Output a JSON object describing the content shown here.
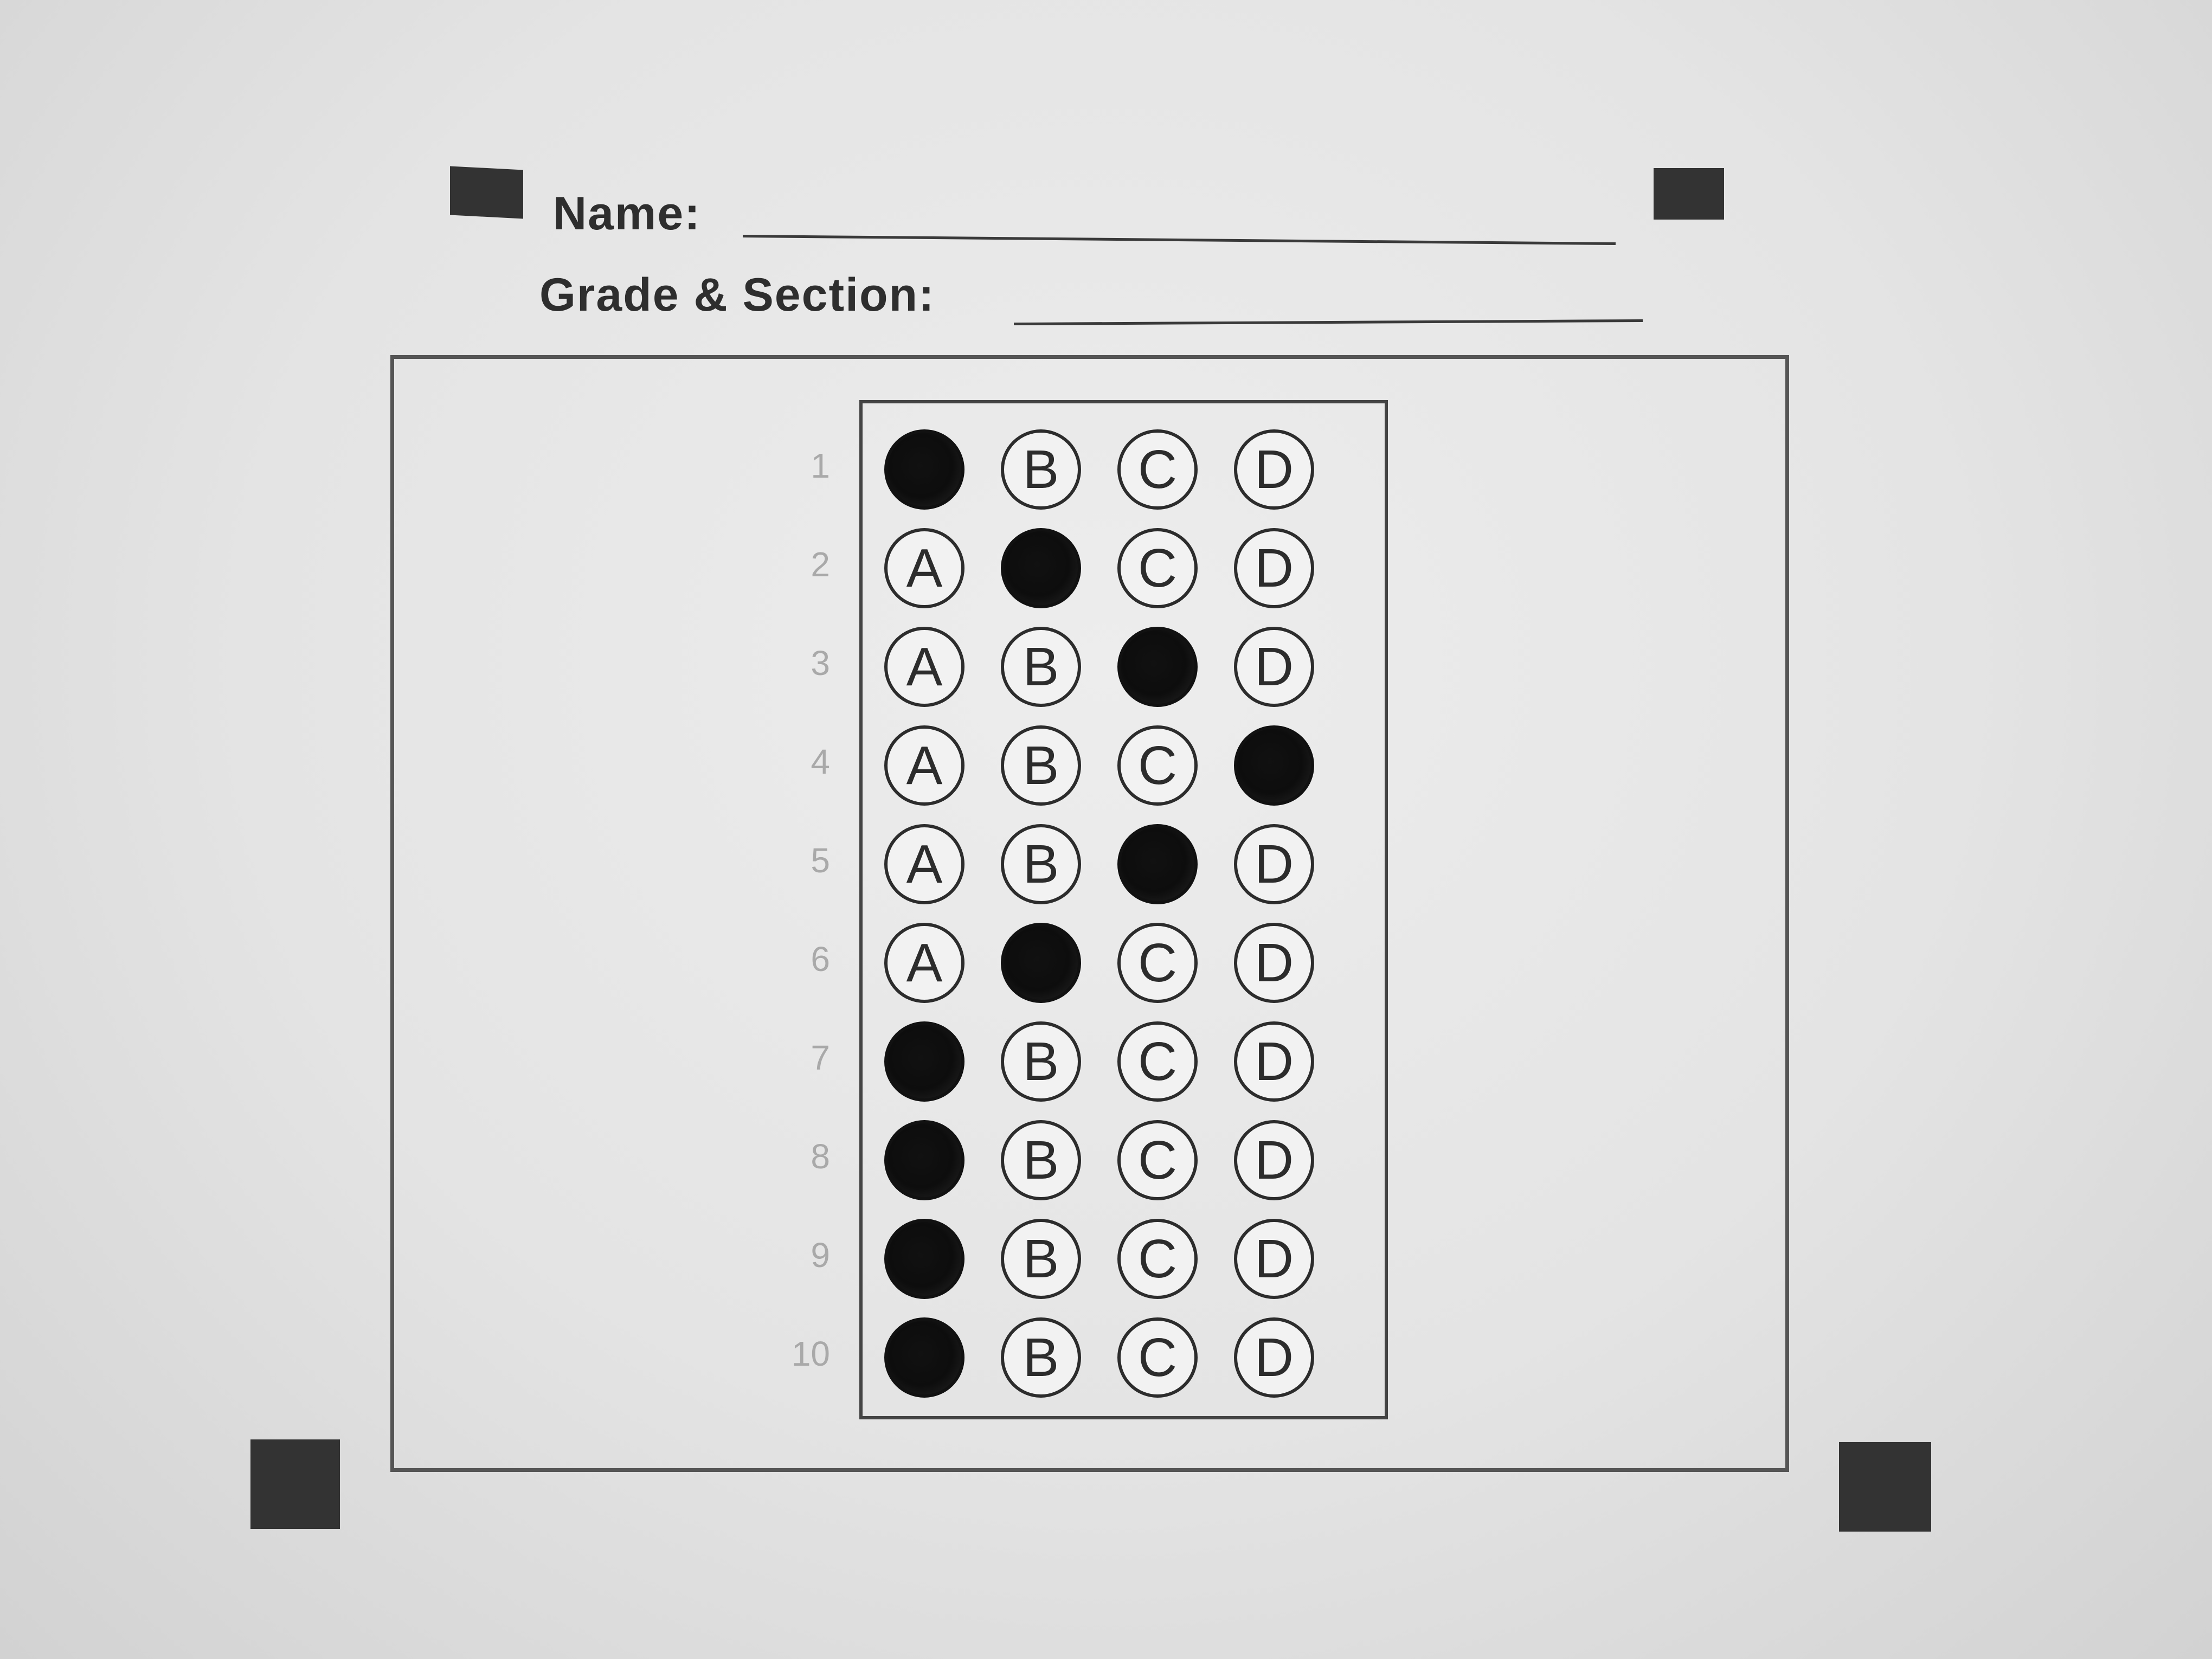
{
  "header": {
    "name_label": "Name:",
    "grade_section_label": "Grade & Section:"
  },
  "answer_sheet": {
    "choices": [
      "A",
      "B",
      "C",
      "D"
    ],
    "questions": [
      {
        "number": "1",
        "selected": "A"
      },
      {
        "number": "2",
        "selected": "B"
      },
      {
        "number": "3",
        "selected": "C"
      },
      {
        "number": "4",
        "selected": "D"
      },
      {
        "number": "5",
        "selected": "C"
      },
      {
        "number": "6",
        "selected": "B"
      },
      {
        "number": "7",
        "selected": "A"
      },
      {
        "number": "8",
        "selected": "A"
      },
      {
        "number": "9",
        "selected": "A"
      },
      {
        "number": "10",
        "selected": "A"
      }
    ]
  }
}
